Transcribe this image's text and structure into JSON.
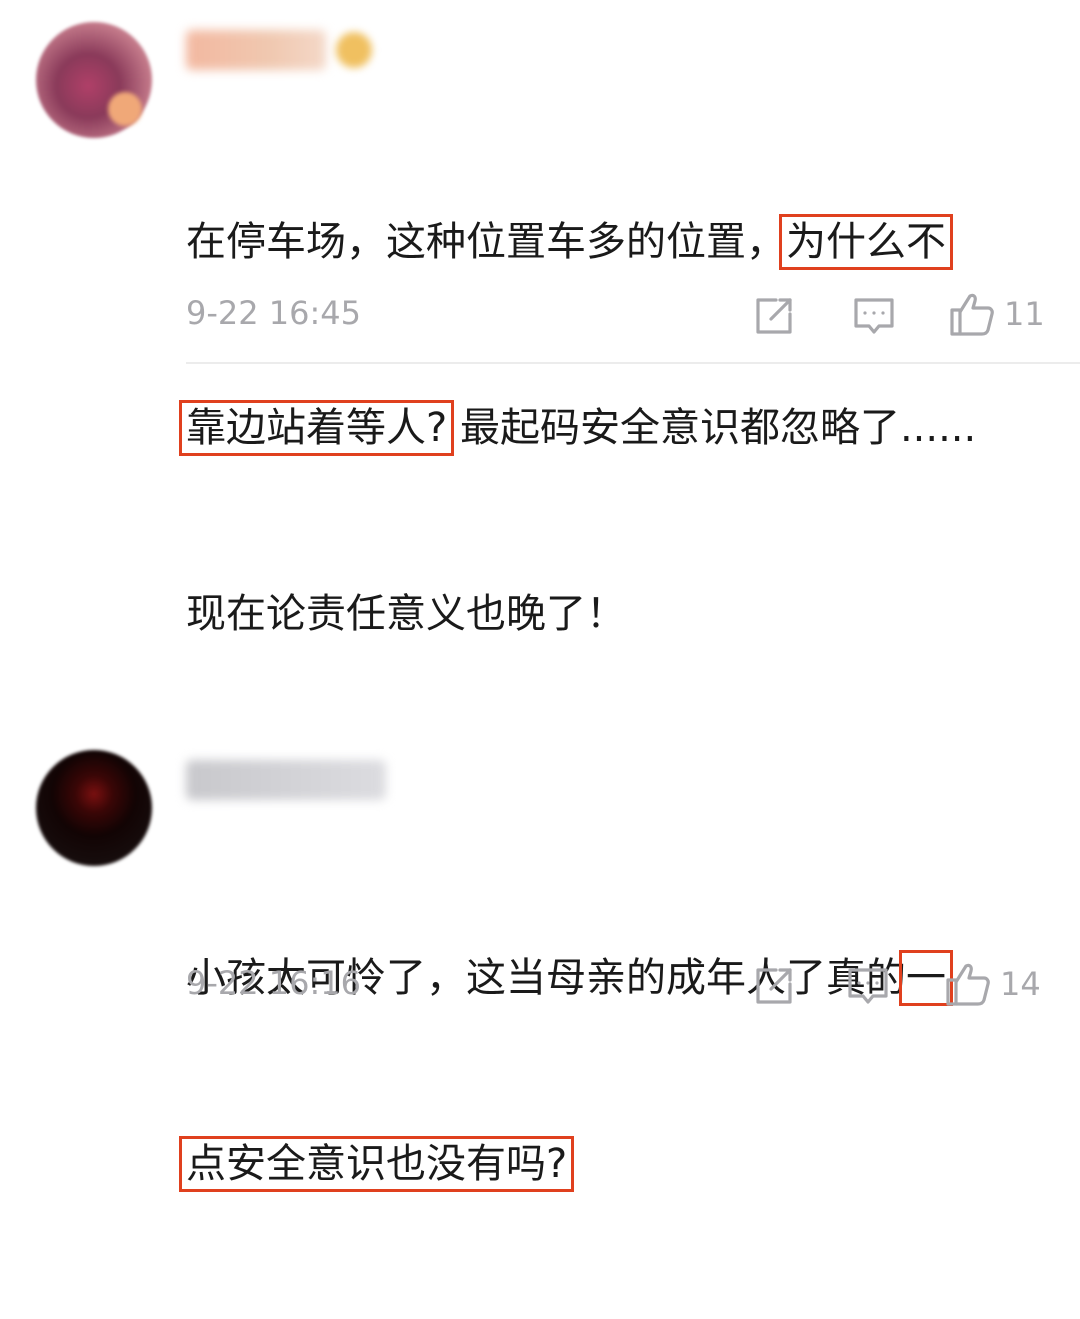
{
  "comments": [
    {
      "content_lines": [
        [
          "在停车场，这种位置车多的位置，",
          "为什么不"
        ],
        [
          "靠边站着等人?",
          " 最起码安全意识都忽略了......"
        ],
        [
          "现在论责任意义也晚了！"
        ]
      ],
      "timestamp": "9-22 16:45",
      "likes": "11"
    },
    {
      "content_lines": [
        [
          "小孩太可怜了，这当母亲的成年人了真的",
          "一"
        ],
        [
          "点安全意识也没有吗?"
        ]
      ],
      "timestamp": "9-22 16:16",
      "likes": "14"
    }
  ],
  "icons": {
    "share": "share-icon",
    "reply": "comment-icon",
    "like": "thumbs-up-icon"
  },
  "colors": {
    "highlight_box": "#e0401e",
    "meta_text": "#a8a8ac",
    "body_text": "#1a1a1a"
  }
}
